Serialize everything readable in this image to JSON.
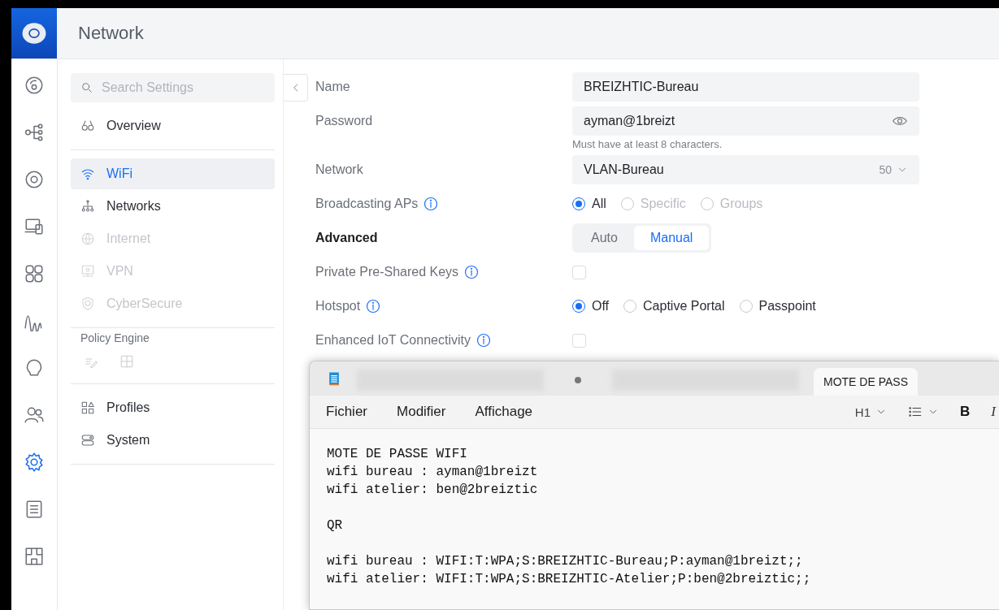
{
  "header": {
    "title": "Network"
  },
  "rail": [
    {
      "selected": false
    },
    {
      "selected": false
    },
    {
      "selected": false
    },
    {
      "selected": false
    },
    {
      "selected": false
    },
    {
      "selected": false
    },
    {
      "selected": false
    },
    {
      "selected": false
    },
    {
      "selected": true
    },
    {
      "selected": false
    },
    {
      "selected": false
    }
  ],
  "sidebar": {
    "search": {
      "placeholder": "Search Settings"
    },
    "groups": [
      {
        "items": [
          {
            "label": "Overview",
            "selected": false,
            "disabled": false
          }
        ]
      },
      {
        "items": [
          {
            "label": "WiFi",
            "selected": true,
            "disabled": false
          },
          {
            "label": "Networks",
            "selected": false,
            "disabled": false
          },
          {
            "label": "Internet",
            "selected": false,
            "disabled": true
          },
          {
            "label": "VPN",
            "selected": false,
            "disabled": true
          },
          {
            "label": "CyberSecure",
            "selected": false,
            "disabled": true
          }
        ]
      },
      {
        "title": "Policy Engine",
        "icons": [
          {
            "disabled": true
          },
          {
            "disabled": true
          }
        ]
      },
      {
        "items": [
          {
            "label": "Profiles",
            "selected": false,
            "disabled": false
          },
          {
            "label": "System",
            "selected": false,
            "disabled": false
          }
        ]
      }
    ]
  },
  "form": {
    "rows": [
      {
        "kind": "text",
        "label": "Name",
        "value": "BREIZHTIC-Bureau"
      },
      {
        "kind": "password",
        "label": "Password",
        "value": "ayman@1breizt",
        "hint": "Must have at least 8 characters."
      },
      {
        "kind": "select",
        "label": "Network",
        "value": "VLAN-Bureau",
        "suffix": "50"
      },
      {
        "kind": "radio",
        "label": "Broadcasting APs",
        "info": true,
        "options": [
          {
            "label": "All",
            "selected": true,
            "disabled": false
          },
          {
            "label": "Specific",
            "selected": false,
            "disabled": true
          },
          {
            "label": "Groups",
            "selected": false,
            "disabled": true
          }
        ]
      },
      {
        "kind": "segmented",
        "label": "Advanced",
        "bold": true,
        "options": [
          {
            "label": "Auto",
            "selected": false
          },
          {
            "label": "Manual",
            "selected": true
          }
        ]
      },
      {
        "kind": "checkbox",
        "label": "Private Pre-Shared Keys",
        "info": true,
        "checked": false
      },
      {
        "kind": "radio",
        "label": "Hotspot",
        "info": true,
        "options": [
          {
            "label": "Off",
            "selected": true,
            "disabled": false
          },
          {
            "label": "Captive Portal",
            "selected": false,
            "disabled": false
          },
          {
            "label": "Passpoint",
            "selected": false,
            "disabled": false
          }
        ]
      },
      {
        "kind": "checkbox",
        "label": "Enhanced IoT Connectivity",
        "info": true,
        "checked": false
      }
    ]
  },
  "notepad": {
    "tabs": [
      {
        "kind": "blurred",
        "selected": false
      },
      {
        "kind": "dot",
        "selected": false
      },
      {
        "kind": "blurred",
        "selected": false
      },
      {
        "kind": "text",
        "label": "MOTE DE PASS",
        "selected": true
      }
    ],
    "menu": [
      "Fichier",
      "Modifier",
      "Affichage"
    ],
    "tools": [
      {
        "kind": "dropdown",
        "label": "H1"
      },
      {
        "kind": "list"
      },
      {
        "kind": "bold",
        "label": "B"
      },
      {
        "kind": "italic",
        "label": "I"
      }
    ],
    "paragraphs": [
      [
        "MOTE DE PASSE WIFI",
        "wifi bureau : ayman@1breizt",
        "wifi atelier: ben@2breiztic"
      ],
      [
        "QR"
      ],
      [
        "wifi bureau : WIFI:T:WPA;S:BREIZHTIC-Bureau;P:ayman@1breizt;;",
        "wifi atelier: WIFI:T:WPA;S:BREIZHTIC-Atelier;P:ben@2breiztic;;"
      ]
    ]
  }
}
